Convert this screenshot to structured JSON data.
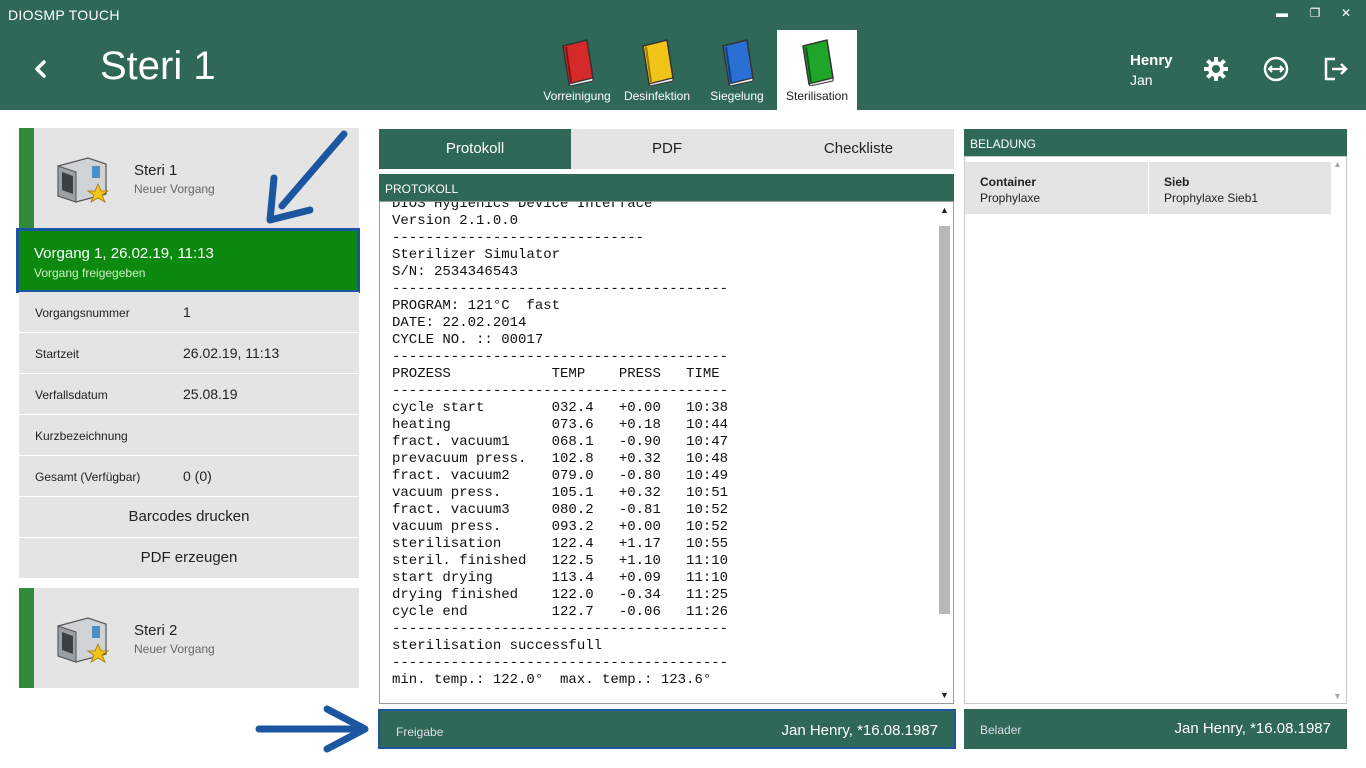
{
  "titlebar": {
    "app_name": "DIOSMP TOUCH",
    "minimize": "▬",
    "maximize": "❐",
    "close": "✕"
  },
  "header": {
    "title": "Steri 1",
    "user_first": "Henry",
    "user_last": "Jan",
    "phases": [
      {
        "label": "Vorreinigung",
        "color": "#d42a2a"
      },
      {
        "label": "Desinfektion",
        "color": "#f0c419"
      },
      {
        "label": "Siegelung",
        "color": "#2a6fd4"
      },
      {
        "label": "Sterilisation",
        "color": "#1fa52a"
      }
    ]
  },
  "left": {
    "device1": {
      "name": "Steri 1",
      "status": "Neuer Vorgang"
    },
    "vorgang": {
      "title": "Vorgang 1, 26.02.19, 11:13",
      "status": "Vorgang freigegeben"
    },
    "rows": [
      {
        "key": "Vorgangsnummer",
        "value": "1"
      },
      {
        "key": "Startzeit",
        "value": "26.02.19, 11:13"
      },
      {
        "key": "Verfallsdatum",
        "value": "25.08.19"
      },
      {
        "key": "Kurzbezeichnung",
        "value": ""
      },
      {
        "key": "Gesamt (Verfügbar)",
        "value": "0 (0)"
      }
    ],
    "barcode_button": "Barcodes drucken",
    "pdf_button": "PDF erzeugen",
    "device2": {
      "name": "Steri 2",
      "status": "Neuer Vorgang"
    }
  },
  "middle": {
    "tabs": [
      "Protokoll",
      "PDF",
      "Checkliste"
    ],
    "protocol_header": "PROTOKOLL",
    "protocol_lines": [
      "DIOS Hygienics Device Interface",
      "Version 2.1.0.0",
      "------------------------------",
      "Sterilizer Simulator",
      "S/N: 2534346543",
      "----------------------------------------",
      "PROGRAM: 121°C  fast",
      "DATE: 22.02.2014",
      "CYCLE NO. :: 00017",
      "----------------------------------------",
      "PROZESS            TEMP    PRESS   TIME",
      "----------------------------------------",
      "cycle start        032.4   +0.00   10:38",
      "heating            073.6   +0.18   10:44",
      "fract. vacuum1     068.1   -0.90   10:47",
      "prevacuum press.   102.8   +0.32   10:48",
      "fract. vacuum2     079.0   -0.80   10:49",
      "vacuum press.      105.1   +0.32   10:51",
      "fract. vacuum3     080.2   -0.81   10:52",
      "vacuum press.      093.2   +0.00   10:52",
      "sterilisation      122.4   +1.17   10:55",
      "steril. finished   122.5   +1.10   11:10",
      "start drying       113.4   +0.09   11:10",
      "drying finished    122.0   -0.34   11:25",
      "cycle end          122.7   -0.06   11:26",
      "----------------------------------------",
      "sterilisation successfull",
      "----------------------------------------",
      "min. temp.: 122.0°  max. temp.: 123.6°"
    ],
    "freigabe_label": "Freigabe",
    "freigabe_value": "Jan Henry, *16.08.1987"
  },
  "right": {
    "header": "BELADUNG",
    "cells": [
      {
        "heading": "Container",
        "text": "Prophylaxe"
      },
      {
        "heading": "Sieb",
        "text": "Prophylaxe Sieb1"
      }
    ],
    "belader_label": "Belader",
    "belader_value": "Jan Henry, *16.08.1987"
  }
}
